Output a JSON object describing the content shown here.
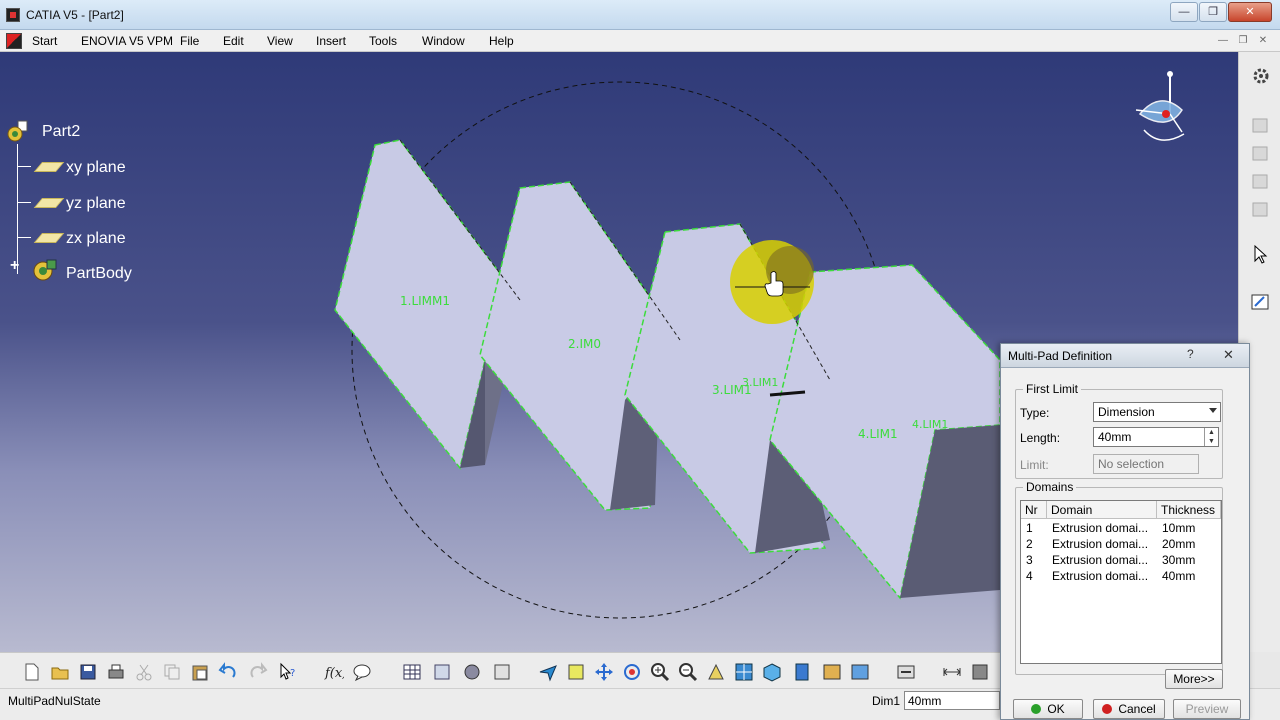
{
  "window": {
    "title": "CATIA V5 - [Part2]"
  },
  "menu": {
    "start": "Start",
    "items": [
      "ENOVIA V5 VPM",
      "File",
      "Edit",
      "View",
      "Insert",
      "Tools",
      "Window",
      "Help"
    ]
  },
  "tree": {
    "root": "Part2",
    "planes": [
      "xy plane",
      "yz plane",
      "zx plane"
    ],
    "body": "PartBody"
  },
  "viewport_labels": [
    "1.LIMM1",
    "2.IM0",
    "3.LIM1",
    "3.LIM1",
    "4.LIM1",
    "4.LIM1"
  ],
  "status": {
    "message": "MultiPadNulState",
    "dim_label": "Dim1",
    "dim_value": "40mm"
  },
  "dialog": {
    "title": "Multi-Pad Definition",
    "help": "?",
    "close": "✕",
    "first_limit": {
      "legend": "First Limit",
      "type_label": "Type:",
      "type_value": "Dimension",
      "length_label": "Length:",
      "length_value": "40mm",
      "limit_label": "Limit:",
      "limit_placeholder": "No selection"
    },
    "domains": {
      "legend": "Domains",
      "columns": [
        "Nr",
        "Domain",
        "Thickness"
      ],
      "rows": [
        {
          "nr": "1",
          "domain": "Extrusion domai...",
          "thickness": "10mm"
        },
        {
          "nr": "2",
          "domain": "Extrusion domai...",
          "thickness": "20mm"
        },
        {
          "nr": "3",
          "domain": "Extrusion domai...",
          "thickness": "30mm"
        },
        {
          "nr": "4",
          "domain": "Extrusion domai...",
          "thickness": "40mm"
        }
      ]
    },
    "more_button": "More>>",
    "ok_button": "OK",
    "cancel_button": "Cancel",
    "preview_button": "Preview"
  },
  "colors": {
    "viewport_top": "#2f3a78",
    "edge_highlight": "#3cdc3c",
    "face": "#c9cbe6"
  }
}
